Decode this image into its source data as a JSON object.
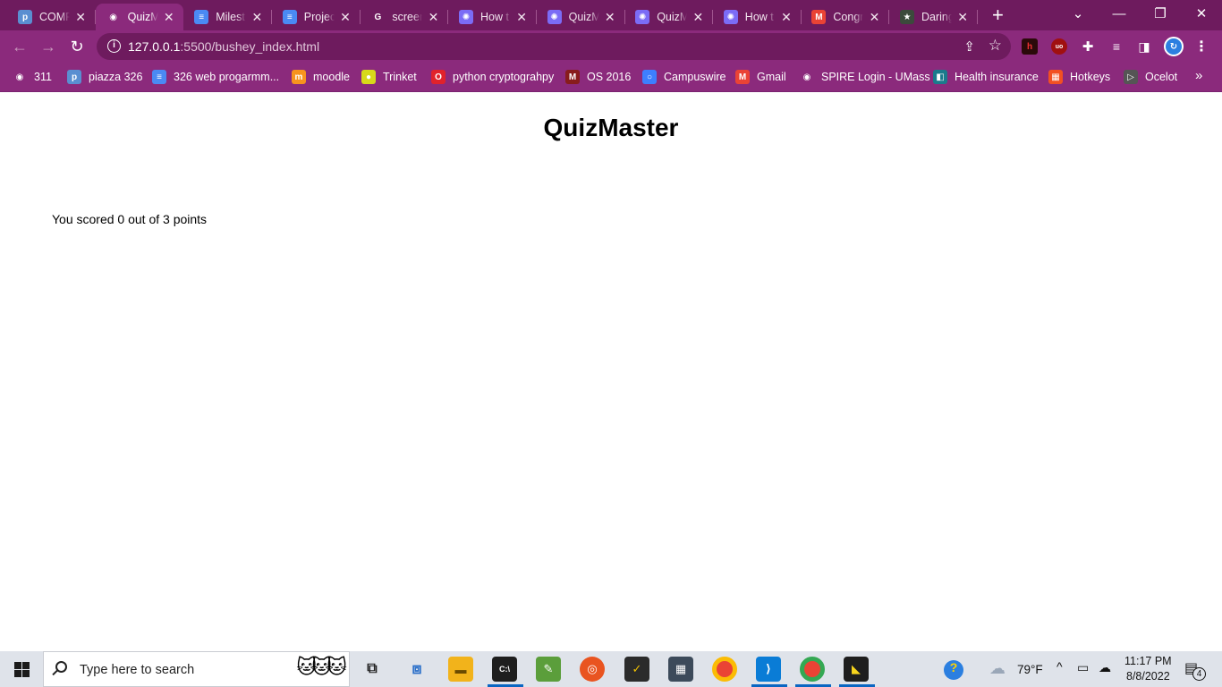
{
  "browser": {
    "tabs": [
      {
        "title": "COMP",
        "icon": "piazza-icon",
        "color": "#5a8fd1",
        "glyph": "p",
        "active": false
      },
      {
        "title": "QuizM",
        "icon": "globe-icon",
        "color": "#ffffff",
        "glyph": "◉",
        "active": true
      },
      {
        "title": "Milest",
        "icon": "docs-icon",
        "color": "#4a8af4",
        "glyph": "≡",
        "active": false
      },
      {
        "title": "Projec",
        "icon": "docs-icon",
        "color": "#4a8af4",
        "glyph": "≡",
        "active": false
      },
      {
        "title": "screen",
        "icon": "google-icon",
        "color": "#ffffff",
        "glyph": "G",
        "active": false
      },
      {
        "title": "How t",
        "icon": "gear-star-icon",
        "color": "#7b6cf6",
        "glyph": "✺",
        "active": false
      },
      {
        "title": "QuizM",
        "icon": "gear-star-icon",
        "color": "#7b6cf6",
        "glyph": "✺",
        "active": false
      },
      {
        "title": "QuizM",
        "icon": "gear-star-icon",
        "color": "#7b6cf6",
        "glyph": "✺",
        "active": false
      },
      {
        "title": "How t",
        "icon": "gear-star-icon",
        "color": "#7b6cf6",
        "glyph": "✺",
        "active": false
      },
      {
        "title": "Congr",
        "icon": "gmail-icon",
        "color": "#ea4335",
        "glyph": "M",
        "active": false
      },
      {
        "title": "Daring",
        "icon": "star-badge-icon",
        "color": "#3c4a3c",
        "glyph": "★",
        "active": false
      }
    ],
    "address": {
      "host": "127.0.0.1",
      "path": ":5500/bushey_index.html"
    },
    "bookmarks": [
      {
        "label": "311",
        "icon": "globe-icon",
        "color": "#ffffff",
        "glyph": "◉"
      },
      {
        "label": "piazza 326",
        "icon": "piazza-icon",
        "color": "#5a8fd1",
        "glyph": "p"
      },
      {
        "label": "326 web progarmm...",
        "icon": "docs-icon",
        "color": "#4a8af4",
        "glyph": "≡"
      },
      {
        "label": "moodle",
        "icon": "moodle-icon",
        "color": "#f7931e",
        "glyph": "m"
      },
      {
        "label": "Trinket",
        "icon": "trinket-icon",
        "color": "#d7d91a",
        "glyph": "●"
      },
      {
        "label": "python cryptograhpy",
        "icon": "opera-icon",
        "color": "#e0222b",
        "glyph": "O"
      },
      {
        "label": "OS 2016",
        "icon": "umass-icon",
        "color": "#881c1c",
        "glyph": "M"
      },
      {
        "label": "Campuswire",
        "icon": "campuswire-icon",
        "color": "#3d7fff",
        "glyph": "○"
      },
      {
        "label": "Gmail",
        "icon": "gmail-icon",
        "color": "#ea4335",
        "glyph": "M"
      },
      {
        "label": "SPIRE Login - UMass",
        "icon": "globe-icon",
        "color": "#ffffff",
        "glyph": "◉"
      },
      {
        "label": "Health insurance",
        "icon": "health-icon",
        "color": "#1b7a8c",
        "glyph": "◧"
      },
      {
        "label": "Hotkeys",
        "icon": "microsoft-icon",
        "color": "#f25022",
        "glyph": "▦"
      },
      {
        "label": "Ocelot",
        "icon": "ocelot-icon",
        "color": "#555555",
        "glyph": "▷"
      }
    ]
  },
  "page": {
    "heading": "QuizMaster",
    "score_text": "You scored 0 out of 3 points"
  },
  "taskbar": {
    "search_placeholder": "Type here to search",
    "weather": "79°F",
    "time": "11:17 PM",
    "date": "8/8/2022",
    "notifications": "4"
  }
}
